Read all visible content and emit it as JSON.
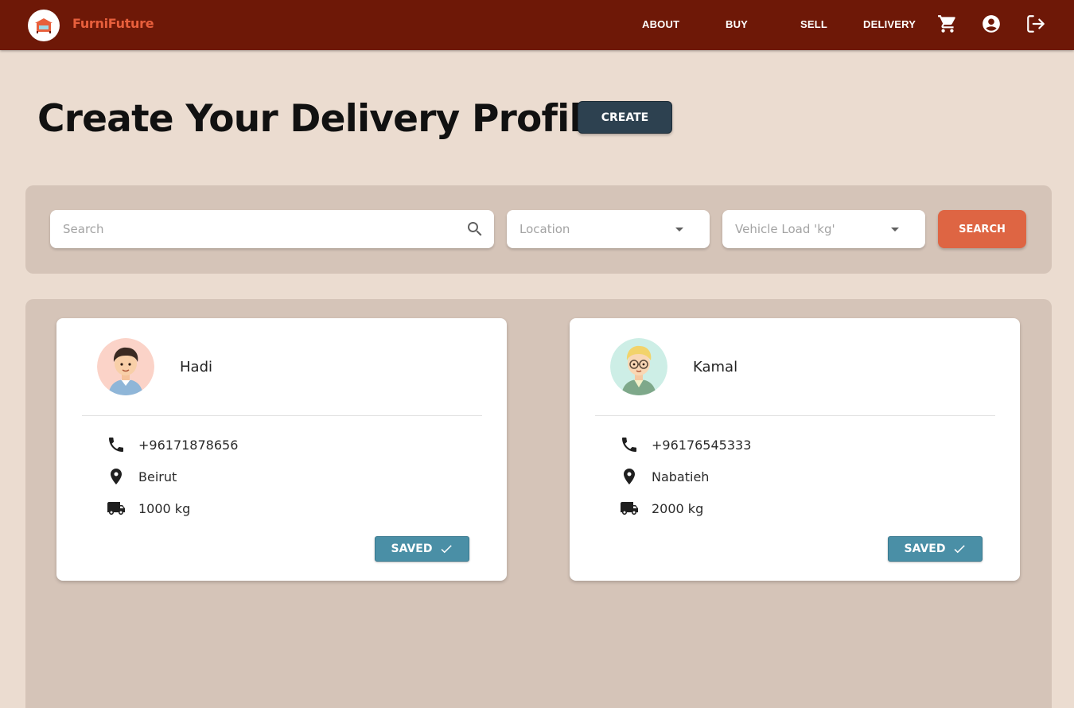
{
  "header": {
    "brand": "FurniFuture",
    "nav": [
      {
        "label": "ABOUT"
      },
      {
        "label": "BUY"
      },
      {
        "label": "SELL"
      },
      {
        "label": "DELIVERY"
      }
    ],
    "icons": [
      "logo-icon",
      "cart-icon",
      "account-icon",
      "logout-icon"
    ],
    "brand_color": "#e85f3c",
    "bar_color": "#6e1807"
  },
  "main": {
    "title": "Create Your Delivery Profile",
    "create_label": "CREATE"
  },
  "filters": {
    "search_placeholder": "Search",
    "location_placeholder": "Location",
    "vehicle_placeholder": "Vehicle Load 'kg'",
    "search_button": "SEARCH"
  },
  "profiles": [
    {
      "name": "Hadi",
      "phone": "+96171878656",
      "location": "Beirut",
      "load": "1000 kg",
      "status": "SAVED"
    },
    {
      "name": "Kamal",
      "phone": "+96176545333",
      "location": "Nabatieh",
      "load": "2000 kg",
      "status": "SAVED"
    }
  ],
  "colors": {
    "page_bg": "#ebdcd0",
    "panel_bg": "#d5c4b8",
    "create_button": "#2d4150",
    "search_button": "#de6543",
    "saved_button": "#4a8fa6"
  }
}
